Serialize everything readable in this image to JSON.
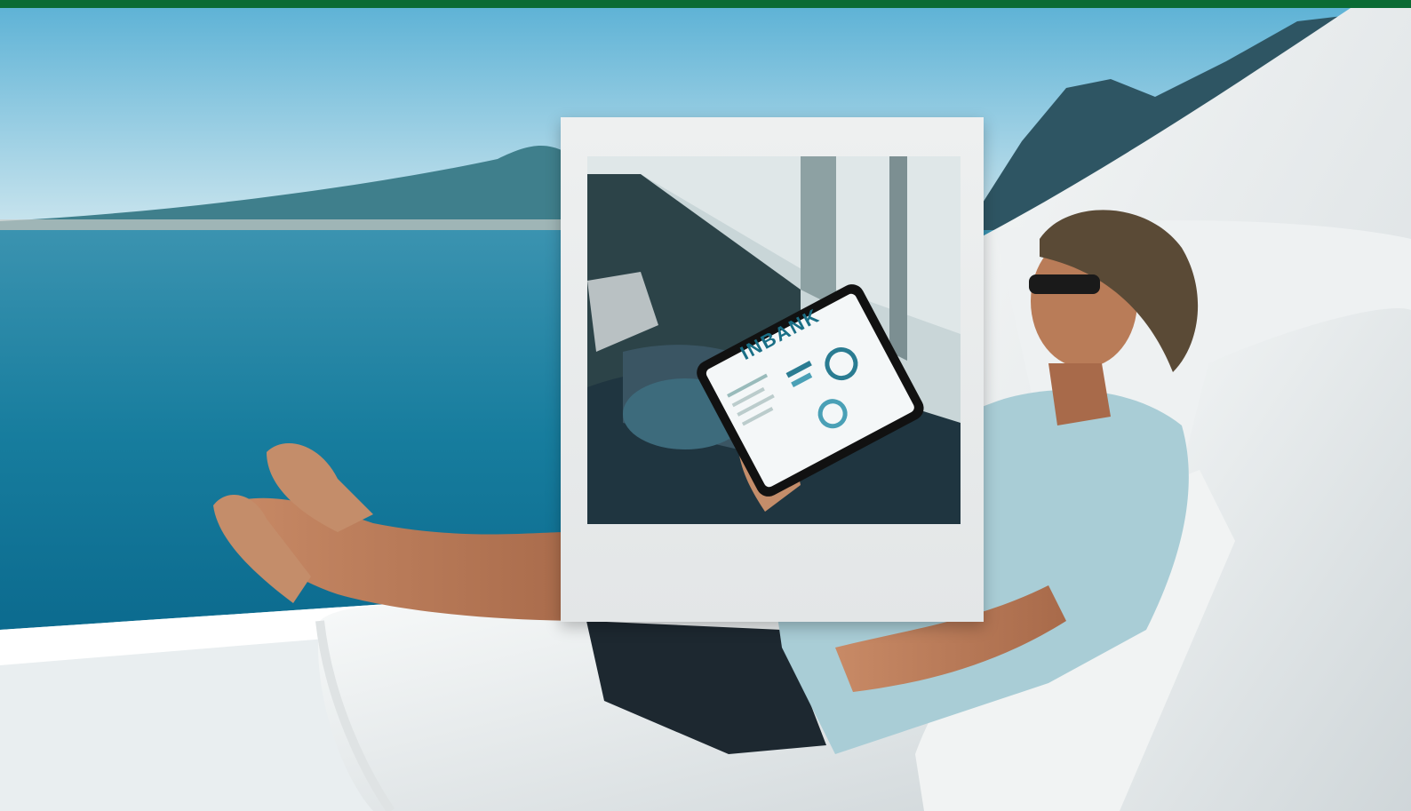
{
  "top_bar": {
    "color": "#0b6b34"
  },
  "scene": {
    "description_icons": [
      "sea",
      "mountains",
      "man-relaxing",
      "daybed",
      "cushions"
    ]
  },
  "polaroid": {
    "tablet_brand": "INBANK"
  }
}
